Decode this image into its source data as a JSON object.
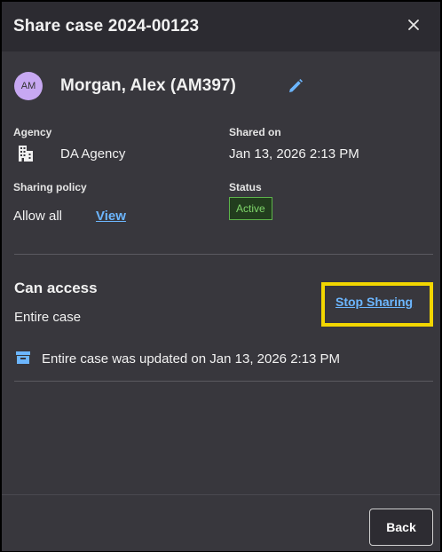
{
  "dialog": {
    "title": "Share case 2024-00123",
    "close_icon": "close-icon"
  },
  "user": {
    "initials": "AM",
    "name": "Morgan, Alex (AM397)",
    "avatar_color": "#c7a8f2",
    "edit_icon": "pencil-icon"
  },
  "details": {
    "agency_label": "Agency",
    "agency_icon": "building-icon",
    "agency_value": "DA Agency",
    "shared_on_label": "Shared on",
    "shared_on_value": "Jan 13, 2026 2:13 PM",
    "sharing_policy_label": "Sharing policy",
    "sharing_policy_value": "Allow all",
    "view_link": "View",
    "status_label": "Status",
    "status_value": "Active",
    "status_color": "#5db34b"
  },
  "access": {
    "title": "Can access",
    "scope": "Entire case",
    "stop_sharing": "Stop Sharing",
    "highlight_color": "#f2d600",
    "update_icon": "archive-icon",
    "update_text": "Entire case was updated on Jan 13, 2026 2:13 PM"
  },
  "footer": {
    "back_label": "Back"
  },
  "theme": {
    "background": "#38373d",
    "header_background": "#2c2b31",
    "link_color": "#6cb6ff"
  }
}
